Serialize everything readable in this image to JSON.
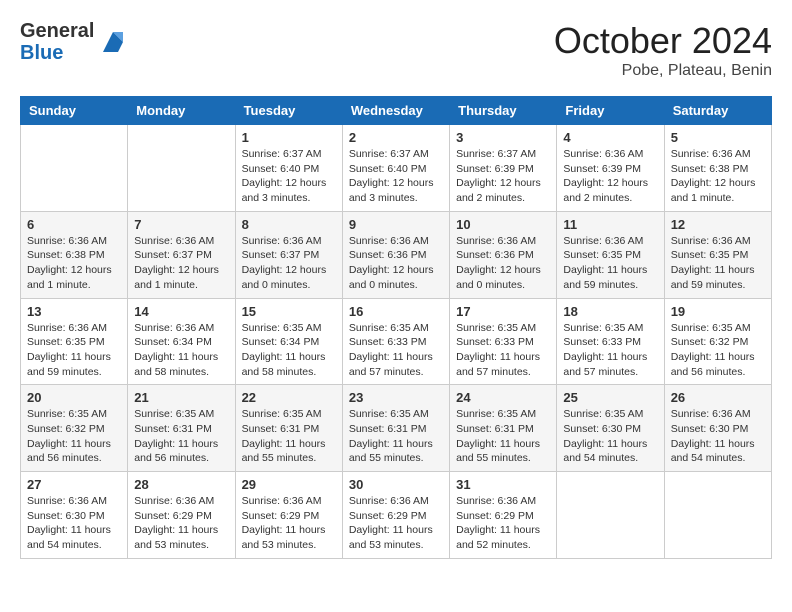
{
  "logo": {
    "general": "General",
    "blue": "Blue"
  },
  "title": "October 2024",
  "subtitle": "Pobe, Plateau, Benin",
  "headers": [
    "Sunday",
    "Monday",
    "Tuesday",
    "Wednesday",
    "Thursday",
    "Friday",
    "Saturday"
  ],
  "weeks": [
    [
      {
        "day": "",
        "info": ""
      },
      {
        "day": "",
        "info": ""
      },
      {
        "day": "1",
        "info": "Sunrise: 6:37 AM\nSunset: 6:40 PM\nDaylight: 12 hours\nand 3 minutes."
      },
      {
        "day": "2",
        "info": "Sunrise: 6:37 AM\nSunset: 6:40 PM\nDaylight: 12 hours\nand 3 minutes."
      },
      {
        "day": "3",
        "info": "Sunrise: 6:37 AM\nSunset: 6:39 PM\nDaylight: 12 hours\nand 2 minutes."
      },
      {
        "day": "4",
        "info": "Sunrise: 6:36 AM\nSunset: 6:39 PM\nDaylight: 12 hours\nand 2 minutes."
      },
      {
        "day": "5",
        "info": "Sunrise: 6:36 AM\nSunset: 6:38 PM\nDaylight: 12 hours\nand 1 minute."
      }
    ],
    [
      {
        "day": "6",
        "info": "Sunrise: 6:36 AM\nSunset: 6:38 PM\nDaylight: 12 hours\nand 1 minute."
      },
      {
        "day": "7",
        "info": "Sunrise: 6:36 AM\nSunset: 6:37 PM\nDaylight: 12 hours\nand 1 minute."
      },
      {
        "day": "8",
        "info": "Sunrise: 6:36 AM\nSunset: 6:37 PM\nDaylight: 12 hours\nand 0 minutes."
      },
      {
        "day": "9",
        "info": "Sunrise: 6:36 AM\nSunset: 6:36 PM\nDaylight: 12 hours\nand 0 minutes."
      },
      {
        "day": "10",
        "info": "Sunrise: 6:36 AM\nSunset: 6:36 PM\nDaylight: 12 hours\nand 0 minutes."
      },
      {
        "day": "11",
        "info": "Sunrise: 6:36 AM\nSunset: 6:35 PM\nDaylight: 11 hours\nand 59 minutes."
      },
      {
        "day": "12",
        "info": "Sunrise: 6:36 AM\nSunset: 6:35 PM\nDaylight: 11 hours\nand 59 minutes."
      }
    ],
    [
      {
        "day": "13",
        "info": "Sunrise: 6:36 AM\nSunset: 6:35 PM\nDaylight: 11 hours\nand 59 minutes."
      },
      {
        "day": "14",
        "info": "Sunrise: 6:36 AM\nSunset: 6:34 PM\nDaylight: 11 hours\nand 58 minutes."
      },
      {
        "day": "15",
        "info": "Sunrise: 6:35 AM\nSunset: 6:34 PM\nDaylight: 11 hours\nand 58 minutes."
      },
      {
        "day": "16",
        "info": "Sunrise: 6:35 AM\nSunset: 6:33 PM\nDaylight: 11 hours\nand 57 minutes."
      },
      {
        "day": "17",
        "info": "Sunrise: 6:35 AM\nSunset: 6:33 PM\nDaylight: 11 hours\nand 57 minutes."
      },
      {
        "day": "18",
        "info": "Sunrise: 6:35 AM\nSunset: 6:33 PM\nDaylight: 11 hours\nand 57 minutes."
      },
      {
        "day": "19",
        "info": "Sunrise: 6:35 AM\nSunset: 6:32 PM\nDaylight: 11 hours\nand 56 minutes."
      }
    ],
    [
      {
        "day": "20",
        "info": "Sunrise: 6:35 AM\nSunset: 6:32 PM\nDaylight: 11 hours\nand 56 minutes."
      },
      {
        "day": "21",
        "info": "Sunrise: 6:35 AM\nSunset: 6:31 PM\nDaylight: 11 hours\nand 56 minutes."
      },
      {
        "day": "22",
        "info": "Sunrise: 6:35 AM\nSunset: 6:31 PM\nDaylight: 11 hours\nand 55 minutes."
      },
      {
        "day": "23",
        "info": "Sunrise: 6:35 AM\nSunset: 6:31 PM\nDaylight: 11 hours\nand 55 minutes."
      },
      {
        "day": "24",
        "info": "Sunrise: 6:35 AM\nSunset: 6:31 PM\nDaylight: 11 hours\nand 55 minutes."
      },
      {
        "day": "25",
        "info": "Sunrise: 6:35 AM\nSunset: 6:30 PM\nDaylight: 11 hours\nand 54 minutes."
      },
      {
        "day": "26",
        "info": "Sunrise: 6:36 AM\nSunset: 6:30 PM\nDaylight: 11 hours\nand 54 minutes."
      }
    ],
    [
      {
        "day": "27",
        "info": "Sunrise: 6:36 AM\nSunset: 6:30 PM\nDaylight: 11 hours\nand 54 minutes."
      },
      {
        "day": "28",
        "info": "Sunrise: 6:36 AM\nSunset: 6:29 PM\nDaylight: 11 hours\nand 53 minutes."
      },
      {
        "day": "29",
        "info": "Sunrise: 6:36 AM\nSunset: 6:29 PM\nDaylight: 11 hours\nand 53 minutes."
      },
      {
        "day": "30",
        "info": "Sunrise: 6:36 AM\nSunset: 6:29 PM\nDaylight: 11 hours\nand 53 minutes."
      },
      {
        "day": "31",
        "info": "Sunrise: 6:36 AM\nSunset: 6:29 PM\nDaylight: 11 hours\nand 52 minutes."
      },
      {
        "day": "",
        "info": ""
      },
      {
        "day": "",
        "info": ""
      }
    ]
  ]
}
